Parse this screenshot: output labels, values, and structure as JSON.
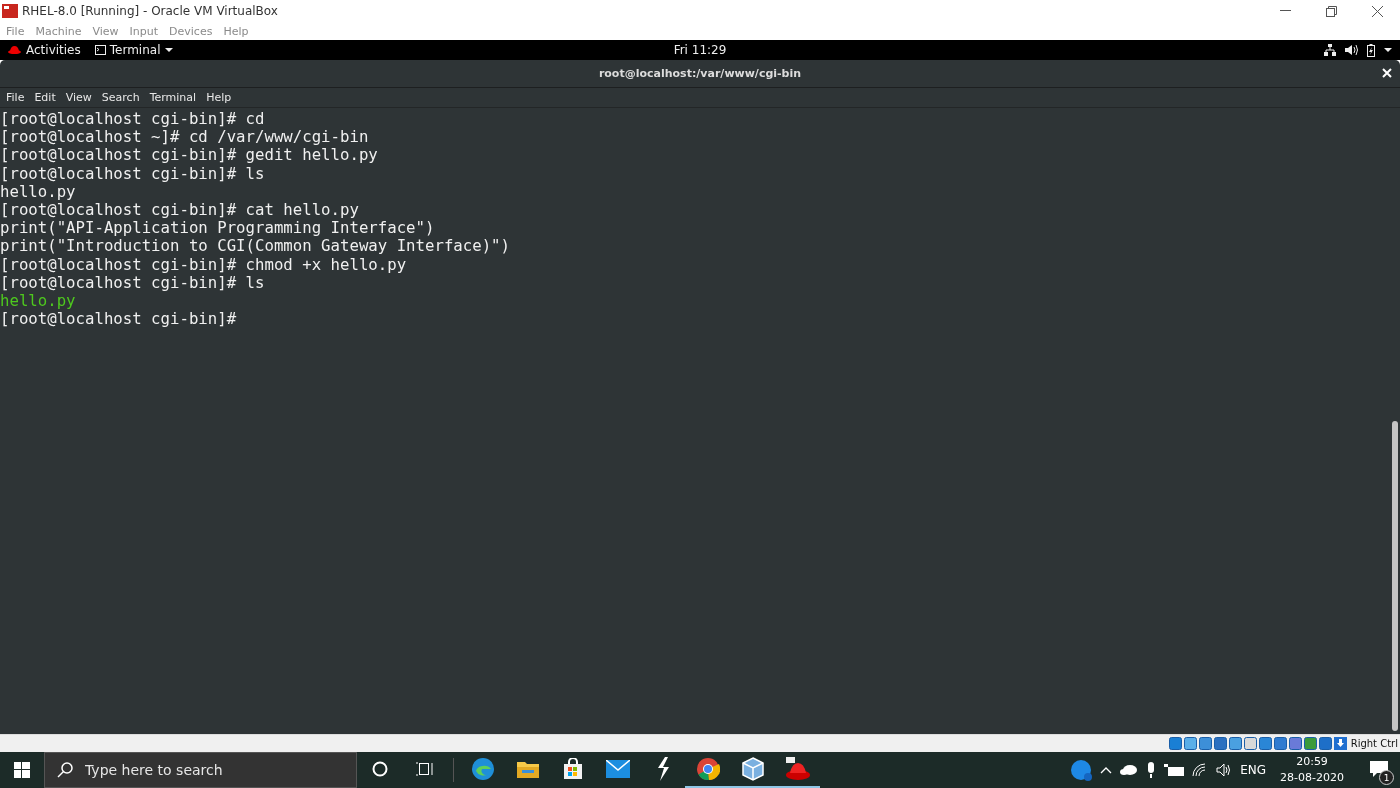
{
  "window": {
    "title": "RHEL-8.0 [Running] - Oracle VM VirtualBox",
    "menu": [
      "File",
      "Machine",
      "View",
      "Input",
      "Devices",
      "Help"
    ]
  },
  "top_bar": {
    "activities": "Activities",
    "app_menu": "Terminal",
    "clock": "Fri 11:29"
  },
  "terminal": {
    "title": "root@localhost:/var/www/cgi-bin",
    "menu": [
      "File",
      "Edit",
      "View",
      "Search",
      "Terminal",
      "Help"
    ],
    "lines": [
      {
        "kind": "text",
        "text": "[root@localhost cgi-bin]# cd"
      },
      {
        "kind": "text",
        "text": "[root@localhost ~]# cd /var/www/cgi-bin"
      },
      {
        "kind": "text",
        "text": "[root@localhost cgi-bin]# gedit hello.py"
      },
      {
        "kind": "text",
        "text": "[root@localhost cgi-bin]# ls"
      },
      {
        "kind": "text",
        "text": "hello.py"
      },
      {
        "kind": "text",
        "text": "[root@localhost cgi-bin]# cat hello.py"
      },
      {
        "kind": "text",
        "text": "print(\"API-Application Programming Interface\")"
      },
      {
        "kind": "text",
        "text": "print(\"Introduction to CGI(Common Gateway Interface)\")"
      },
      {
        "kind": "text",
        "text": "[root@localhost cgi-bin]# chmod +x hello.py"
      },
      {
        "kind": "text",
        "text": "[root@localhost cgi-bin]# ls"
      },
      {
        "kind": "executable",
        "text": "hello.py"
      },
      {
        "kind": "text",
        "text": "[root@localhost cgi-bin]#"
      }
    ]
  },
  "vbox_status": {
    "host_key": "Right Ctrl"
  },
  "taskbar": {
    "search": {
      "placeholder": "Type here to search"
    },
    "apps": [
      {
        "kind": "edge",
        "running": false
      },
      {
        "kind": "folder",
        "running": false
      },
      {
        "kind": "store",
        "running": false
      },
      {
        "kind": "mail",
        "running": false
      },
      {
        "kind": "bolt",
        "running": false
      },
      {
        "kind": "chrome",
        "running": true
      },
      {
        "kind": "cube",
        "running": true
      },
      {
        "kind": "hat",
        "running": true
      }
    ],
    "language": "ENG",
    "time": "20:59",
    "date": "28-08-2020",
    "notifications": "1"
  }
}
